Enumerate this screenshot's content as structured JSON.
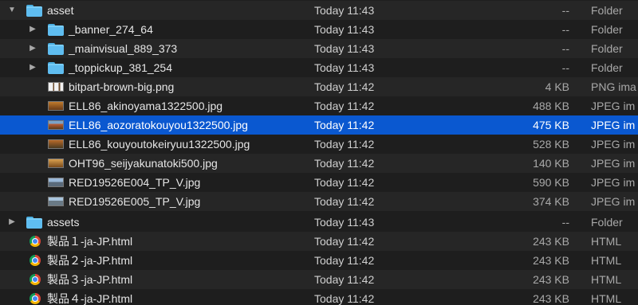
{
  "rows": [
    {
      "name": "asset",
      "date": "Today 11:43",
      "size": "--",
      "kind": "Folder",
      "disclosure": "▼",
      "icon": "folder-icon"
    },
    {
      "name": "_banner_274_64",
      "date": "Today 11:43",
      "size": "--",
      "kind": "Folder",
      "disclosure": "▶",
      "icon": "folder-icon"
    },
    {
      "name": "_mainvisual_889_373",
      "date": "Today 11:43",
      "size": "--",
      "kind": "Folder",
      "disclosure": "▶",
      "icon": "folder-icon"
    },
    {
      "name": "_toppickup_381_254",
      "date": "Today 11:43",
      "size": "--",
      "kind": "Folder",
      "disclosure": "▶",
      "icon": "folder-icon"
    },
    {
      "name": "bitpart-brown-big.png",
      "date": "Today 11:42",
      "size": "4 KB",
      "kind": "PNG ima",
      "icon": "png-thumbnail-icon"
    },
    {
      "name": "ELL86_akinoyama1322500.jpg",
      "date": "Today 11:42",
      "size": "488 KB",
      "kind": "JPEG im",
      "icon": "jpeg-thumbnail-icon"
    },
    {
      "name": "ELL86_aozoratokouyou1322500.jpg",
      "date": "Today 11:42",
      "size": "475 KB",
      "kind": "JPEG im",
      "icon": "jpeg-thumbnail-icon"
    },
    {
      "name": "ELL86_kouyoutokeiryuu1322500.jpg",
      "date": "Today 11:42",
      "size": "528 KB",
      "kind": "JPEG im",
      "icon": "jpeg-thumbnail-icon"
    },
    {
      "name": "OHT96_seijyakunatoki500.jpg",
      "date": "Today 11:42",
      "size": "140 KB",
      "kind": "JPEG im",
      "icon": "jpeg-thumbnail-icon"
    },
    {
      "name": "RED19526E004_TP_V.jpg",
      "date": "Today 11:42",
      "size": "590 KB",
      "kind": "JPEG im",
      "icon": "jpeg-thumbnail-icon"
    },
    {
      "name": "RED19526E005_TP_V.jpg",
      "date": "Today 11:42",
      "size": "374 KB",
      "kind": "JPEG im",
      "icon": "jpeg-thumbnail-icon"
    },
    {
      "name": "assets",
      "date": "Today 11:43",
      "size": "--",
      "kind": "Folder",
      "disclosure": "▶",
      "icon": "folder-icon"
    },
    {
      "name": "製品１-ja-JP.html",
      "date": "Today 11:42",
      "size": "243 KB",
      "kind": "HTML",
      "icon": "chrome-html-icon"
    },
    {
      "name": "製品２-ja-JP.html",
      "date": "Today 11:42",
      "size": "243 KB",
      "kind": "HTML",
      "icon": "chrome-html-icon"
    },
    {
      "name": "製品３-ja-JP.html",
      "date": "Today 11:42",
      "size": "243 KB",
      "kind": "HTML",
      "icon": "chrome-html-icon"
    },
    {
      "name": "製品４-ja-JP.html",
      "date": "Today 11:42",
      "size": "243 KB",
      "kind": "HTML",
      "icon": "chrome-html-icon"
    }
  ],
  "selected_row": "ELL86_aozoratokouyou1322500.jpg",
  "colors": {
    "background": "#1e1e1e",
    "alternate_row": "#262626",
    "selection": "#0a58d0",
    "folder": "#5fbdf0"
  }
}
